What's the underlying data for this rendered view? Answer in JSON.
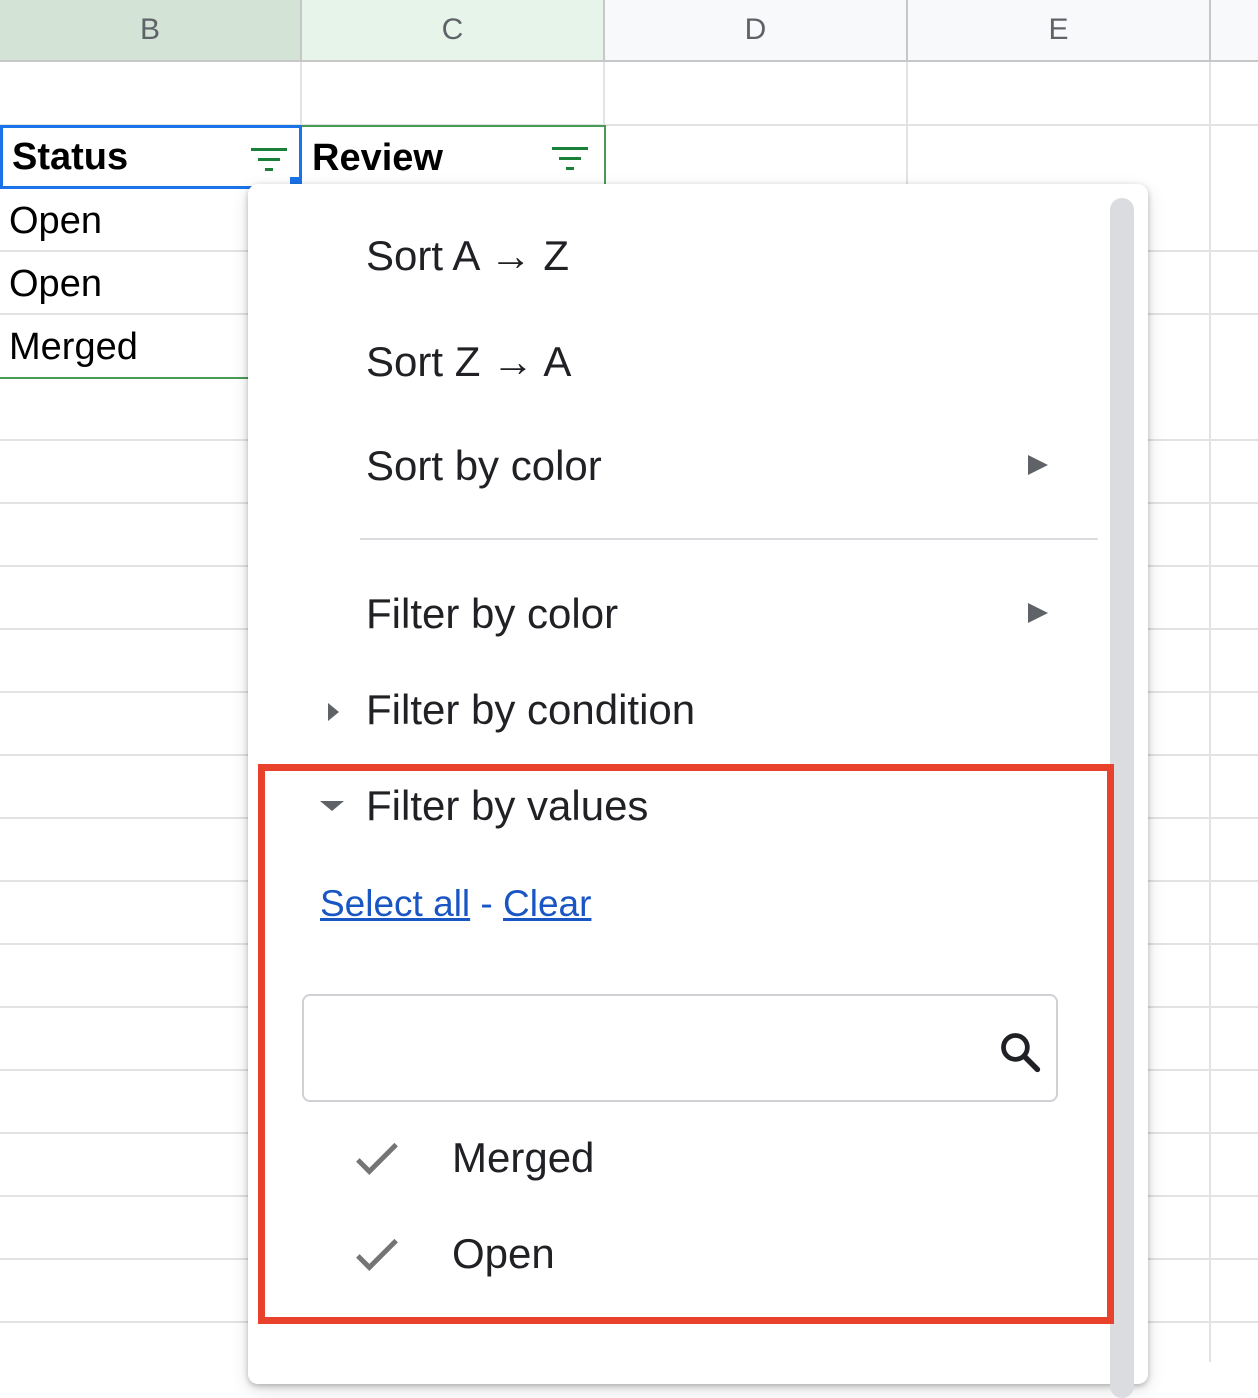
{
  "columns": {
    "b": "B",
    "c": "C",
    "d": "D",
    "e": "E"
  },
  "sheet": {
    "header": {
      "status": "Status",
      "review": "Review"
    },
    "rows": [
      "Open",
      "Open",
      "Merged"
    ]
  },
  "menu": {
    "sort_az": "Sort A → Z",
    "sort_za": "Sort Z → A",
    "sort_by_color": "Sort by color",
    "filter_by_color": "Filter by color",
    "filter_by_condition": "Filter by condition",
    "filter_by_values": "Filter by values",
    "select_all": "Select all",
    "separator": "-",
    "clear": "Clear",
    "search": {
      "value": "",
      "placeholder": "",
      "icon": "search-icon"
    },
    "values": [
      {
        "label": "Merged",
        "checked": true
      },
      {
        "label": "Open",
        "checked": true
      }
    ]
  },
  "colors": {
    "highlight": "#e8412c",
    "filter_green": "#188038",
    "selection_blue": "#1a73e8",
    "link_blue": "#1a55c4"
  }
}
